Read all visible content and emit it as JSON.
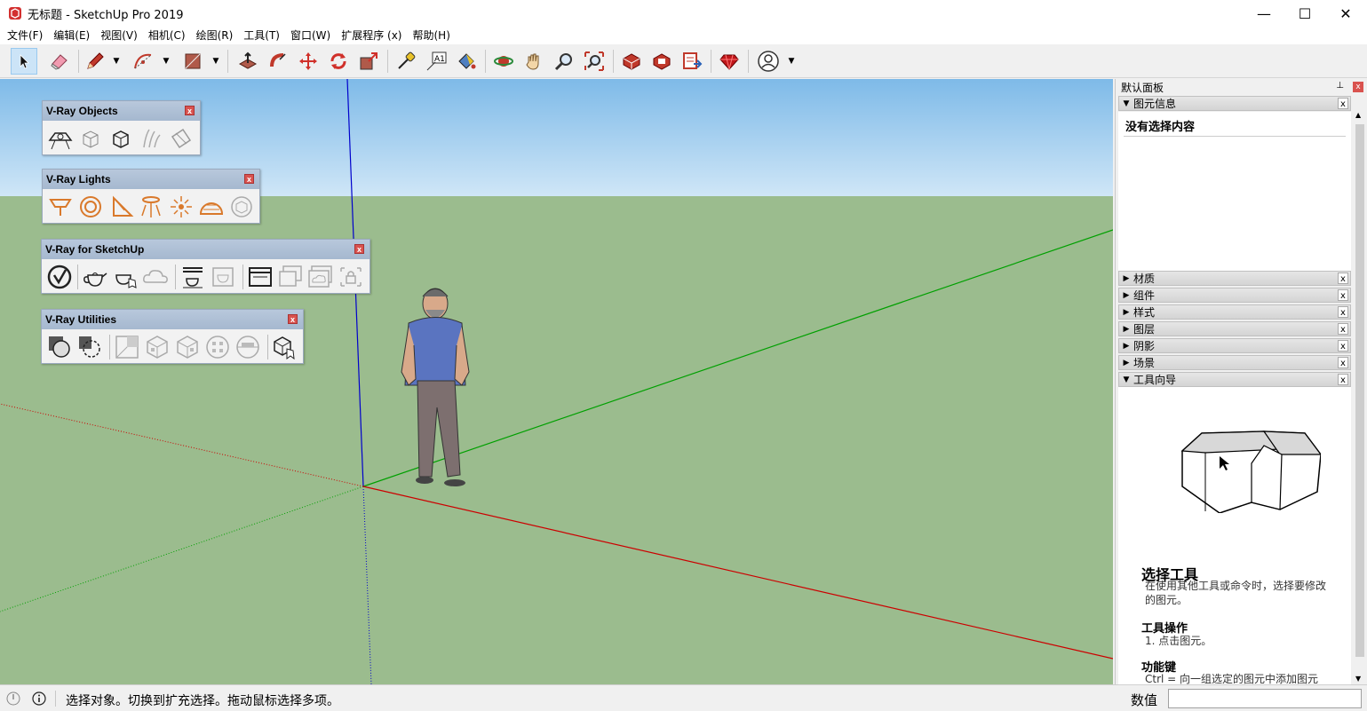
{
  "window": {
    "title": "无标题 - SketchUp Pro 2019",
    "minimize_glyph": "—",
    "maximize_glyph": "☐",
    "close_glyph": "✕"
  },
  "menu": [
    {
      "label": "文件(F)"
    },
    {
      "label": "编辑(E)"
    },
    {
      "label": "视图(V)"
    },
    {
      "label": "相机(C)"
    },
    {
      "label": "绘图(R)"
    },
    {
      "label": "工具(T)"
    },
    {
      "label": "窗口(W)"
    },
    {
      "label": "扩展程序 (x)"
    },
    {
      "label": "帮助(H)"
    }
  ],
  "toolbar": {
    "tools": [
      "select-tool",
      "eraser-tool",
      "pencil-tool",
      "arc-tool",
      "shape-tool",
      "push-pull-tool",
      "follow-me-tool",
      "move-tool",
      "rotate-tool",
      "scale-tool",
      "tape-measure-tool",
      "text-tool",
      "paint-bucket-tool",
      "orbit-tool",
      "pan-tool",
      "zoom-tool",
      "zoom-extents-tool",
      "warehouse-tool",
      "extension-warehouse-tool",
      "send-layout-tool",
      "ruby-tool",
      "account-tool"
    ],
    "text_tool_label": "A1"
  },
  "vray_panels": [
    {
      "title": "V-Ray Objects",
      "close": "x"
    },
    {
      "title": "V-Ray Lights",
      "close": "x"
    },
    {
      "title": "V-Ray for SketchUp",
      "close": "x"
    },
    {
      "title": "V-Ray Utilities",
      "close": "x"
    }
  ],
  "right_panel": {
    "title": "默认面板",
    "pin": "⊥",
    "close": "x",
    "entity_info": {
      "label": "图元信息",
      "content": "没有选择内容"
    },
    "sections": [
      {
        "label": "材质"
      },
      {
        "label": "组件"
      },
      {
        "label": "样式"
      },
      {
        "label": "图层"
      },
      {
        "label": "阴影"
      },
      {
        "label": "场景"
      }
    ],
    "instructor": {
      "label": "工具向导",
      "heading": "选择工具",
      "description": "在使用其他工具或命令时，选择要修改的图元。",
      "ops_heading": "工具操作",
      "ops_item": "1. 点击图元。",
      "keys_heading": "功能键",
      "keys_item": "Ctrl = 向一组选定的图元中添加图元"
    },
    "section_close": "x"
  },
  "status": {
    "message": "选择对象。切换到扩充选择。拖动鼠标选择多项。",
    "measure_label": "数值",
    "measure_value": ""
  },
  "colors": {
    "ground": "#9bbc8e",
    "axis_red": "#cc0000",
    "axis_green": "#00a000",
    "axis_blue": "#0000cc",
    "vray_orange": "#d9792b"
  }
}
